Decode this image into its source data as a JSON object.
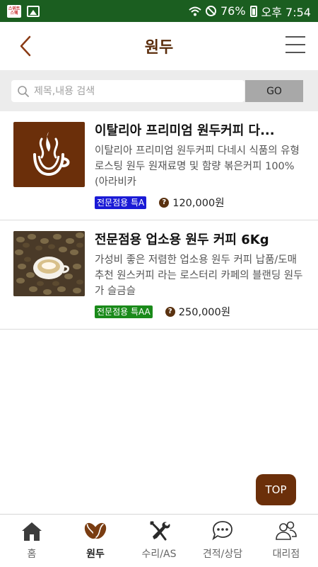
{
  "status_bar": {
    "app_icon_text": "스위트 스웨",
    "battery": "76%",
    "time": "오후 7:54"
  },
  "header": {
    "title": "원두"
  },
  "search": {
    "placeholder": "제목,내용 검색",
    "value": "",
    "go_label": "GO"
  },
  "products": [
    {
      "title": "이탈리아 프리미엄 원두커피 다...",
      "description": "이탈리아 프리미엄 원두커피 다네시 식품의 유형 로스팅 원두 원재료명 및 함량 볶은커피 100% (아라비카",
      "badge": "전문점용 특A",
      "badge_color": "#1a1ad6",
      "price": "120,000원",
      "thumb": "coffee-cup-logo"
    },
    {
      "title": "전문점용 업소용 원두 커피 6Kg",
      "description": "가성비 좋은 저렴한 업소용 원두 커피 납품/도매 추천 원스커피 라는 로스터리 카페의 블랜딩 원두가 슬금슬",
      "badge": "전문점용 특AA",
      "badge_color": "#1a8a1a",
      "price": "250,000원",
      "thumb": "coffee-beans-photo"
    }
  ],
  "top_button": "TOP",
  "colors": {
    "status_bar": "#1b5e20",
    "title": "#5a2c0b",
    "accent": "#6b2f0a"
  },
  "nav": [
    {
      "label": "홈",
      "icon": "home-icon",
      "active": false
    },
    {
      "label": "원두",
      "icon": "coffee-bean-icon",
      "active": true
    },
    {
      "label": "수리/AS",
      "icon": "tools-icon",
      "active": false
    },
    {
      "label": "견적/상담",
      "icon": "chat-icon",
      "active": false
    },
    {
      "label": "대리점",
      "icon": "people-icon",
      "active": false
    }
  ]
}
